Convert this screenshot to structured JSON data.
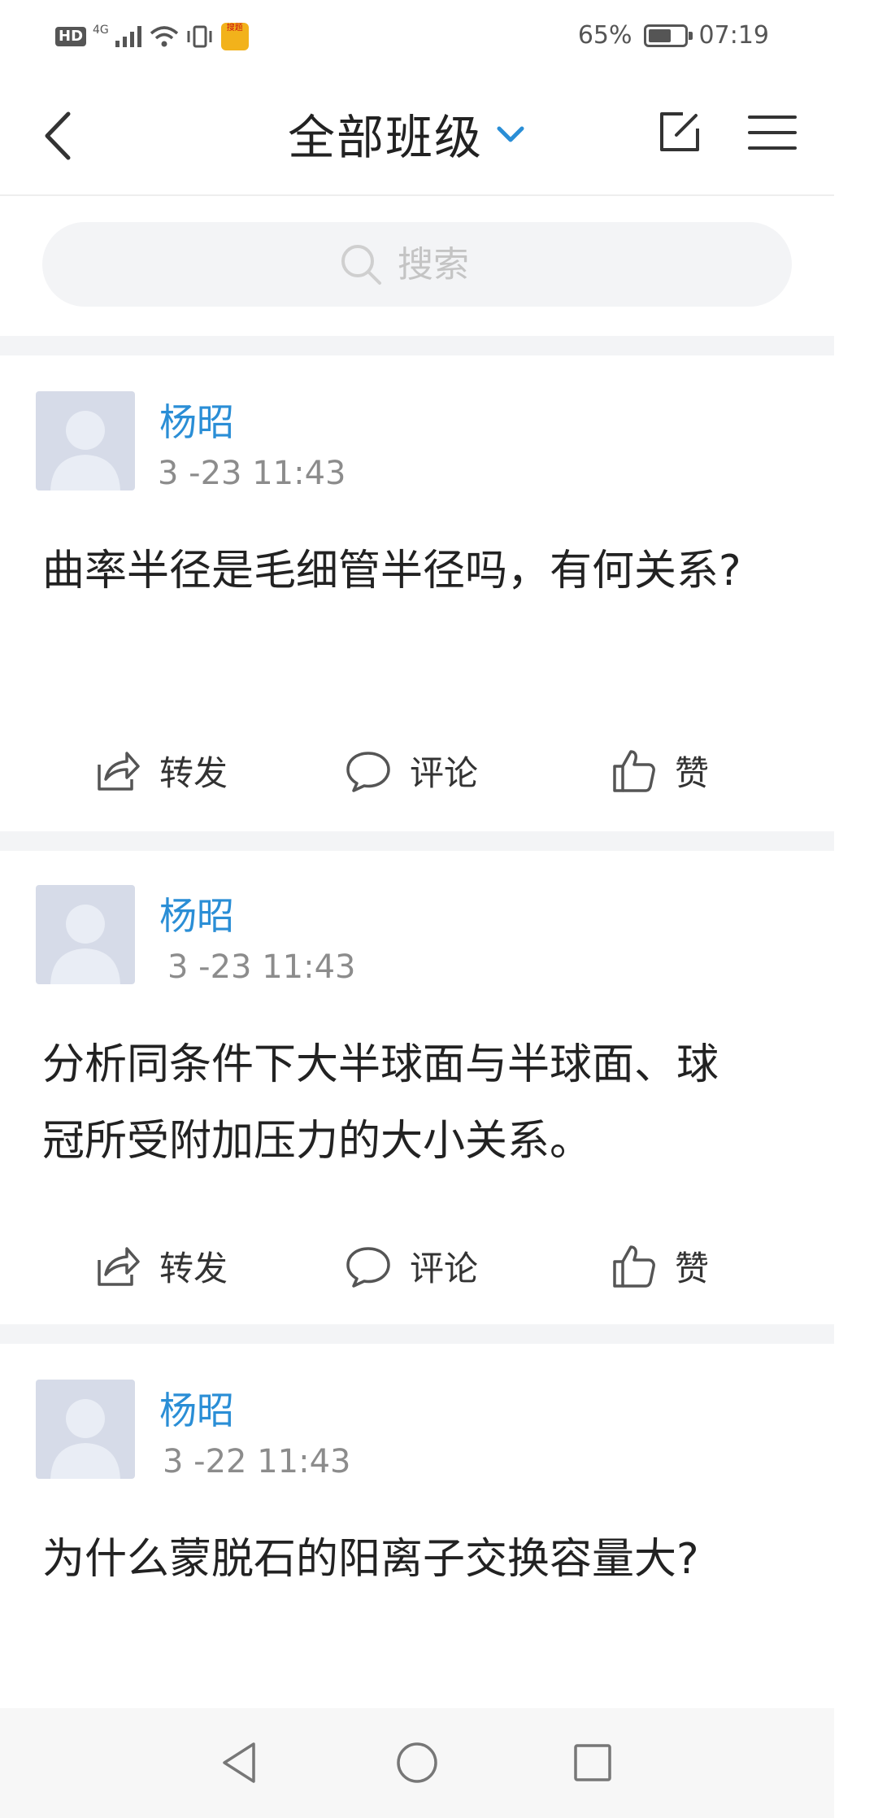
{
  "status_bar": {
    "hd": "HD",
    "network": "4G",
    "app_badge": "搜题",
    "battery": "65%",
    "time": "07:19",
    "battery_level": 0.65
  },
  "nav": {
    "title": "全部班级",
    "accent_color": "#2a8ed6"
  },
  "search": {
    "placeholder": "搜索"
  },
  "posts": [
    {
      "author": "杨昭",
      "time": "3 -23 11:43",
      "text": "曲率半径是毛细管半径吗，有何关系?",
      "actions": {
        "share": "转发",
        "comment": "评论",
        "like": "赞"
      }
    },
    {
      "author": "杨昭",
      "time": "3 -23 11:43",
      "text": "分析同条件下大半球面与半球面、球冠所受附加压力的大小关系。",
      "actions": {
        "share": "转发",
        "comment": "评论",
        "like": "赞"
      }
    },
    {
      "author": "杨昭",
      "time": "3 -22 11:43",
      "text": "为什么蒙脱石的阳离子交换容量大?"
    }
  ]
}
